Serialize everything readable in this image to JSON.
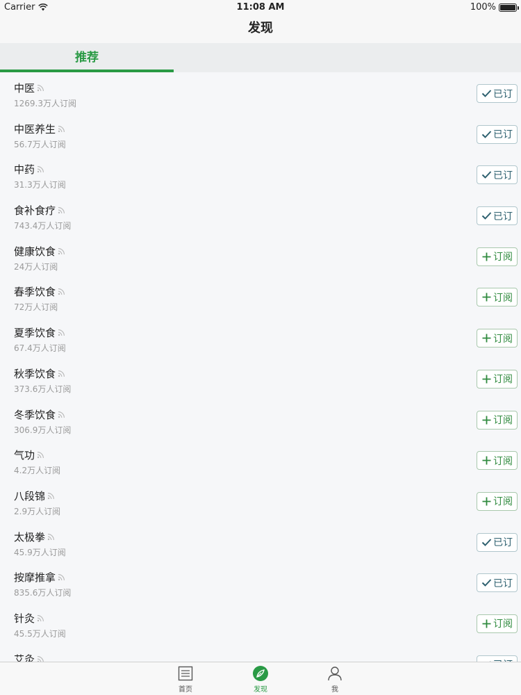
{
  "status_bar": {
    "carrier": "Carrier",
    "time": "11:08 AM",
    "battery": "100%"
  },
  "nav": {
    "title": "发现"
  },
  "top_tabs": [
    {
      "label": "推荐",
      "active": true
    }
  ],
  "colors": {
    "accent": "#2a9a45",
    "subscribed_text": "#2c5f6e"
  },
  "channels": [
    {
      "name": "中医",
      "subscribers": "1269.3万人订阅",
      "action": "已订",
      "subscribed": true
    },
    {
      "name": "中医养生",
      "subscribers": "56.7万人订阅",
      "action": "已订",
      "subscribed": true
    },
    {
      "name": "中药",
      "subscribers": "31.3万人订阅",
      "action": "已订",
      "subscribed": true
    },
    {
      "name": "食补食疗",
      "subscribers": "743.4万人订阅",
      "action": "已订",
      "subscribed": true
    },
    {
      "name": "健康饮食",
      "subscribers": "24万人订阅",
      "action": "订阅",
      "subscribed": false
    },
    {
      "name": "春季饮食",
      "subscribers": "72万人订阅",
      "action": "订阅",
      "subscribed": false
    },
    {
      "name": "夏季饮食",
      "subscribers": "67.4万人订阅",
      "action": "订阅",
      "subscribed": false
    },
    {
      "name": "秋季饮食",
      "subscribers": "373.6万人订阅",
      "action": "订阅",
      "subscribed": false
    },
    {
      "name": "冬季饮食",
      "subscribers": "306.9万人订阅",
      "action": "订阅",
      "subscribed": false
    },
    {
      "name": "气功",
      "subscribers": "4.2万人订阅",
      "action": "订阅",
      "subscribed": false
    },
    {
      "name": "八段锦",
      "subscribers": "2.9万人订阅",
      "action": "订阅",
      "subscribed": false
    },
    {
      "name": "太极拳",
      "subscribers": "45.9万人订阅",
      "action": "已订",
      "subscribed": true
    },
    {
      "name": "按摩推拿",
      "subscribers": "835.6万人订阅",
      "action": "已订",
      "subscribed": true
    },
    {
      "name": "针灸",
      "subscribers": "45.5万人订阅",
      "action": "订阅",
      "subscribed": false
    },
    {
      "name": "艾灸",
      "subscribers": "",
      "action": "已订",
      "subscribed": true
    }
  ],
  "bottom_tabs": [
    {
      "label": "首页",
      "icon": "document-icon",
      "active": false
    },
    {
      "label": "发现",
      "icon": "compass-leaf-icon",
      "active": true
    },
    {
      "label": "我",
      "icon": "person-icon",
      "active": false
    }
  ]
}
